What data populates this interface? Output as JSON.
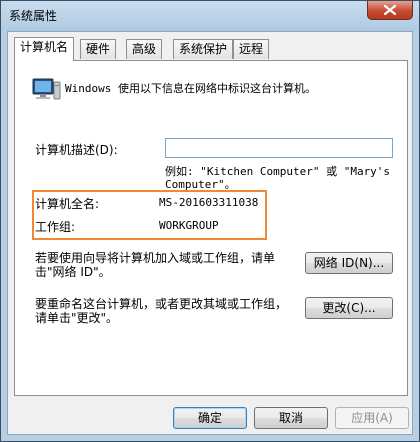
{
  "window": {
    "title": "系统属性"
  },
  "tabs": [
    {
      "label": "计算机名"
    },
    {
      "label": "硬件"
    },
    {
      "label": "高级"
    },
    {
      "label": "系统保护"
    },
    {
      "label": "远程"
    }
  ],
  "panel": {
    "intro": "Windows 使用以下信息在网络中标识这台计算机。",
    "description_label": "计算机描述(D):",
    "description_value": "",
    "description_hint": "例如: \"Kitchen Computer\" 或 \"Mary's Computer\"。",
    "full_name_label": "计算机全名:",
    "full_name_value": "MS-201603311038",
    "workgroup_label": "工作组:",
    "workgroup_value": "WORKGROUP",
    "network_text": "若要使用向导将计算机加入域或工作组，请单击\"网络 ID\"。",
    "network_button": "网络 ID(N)...",
    "rename_text": "要重命名这台计算机，或者更改其域或工作组，请单击\"更改\"。",
    "change_button": "更改(C)..."
  },
  "footer": {
    "ok": "确定",
    "cancel": "取消",
    "apply": "应用(A)"
  },
  "colors": {
    "highlight_border": "#f0883a",
    "titlebar": "#b6cfe4",
    "close_button": "#c64b33"
  }
}
